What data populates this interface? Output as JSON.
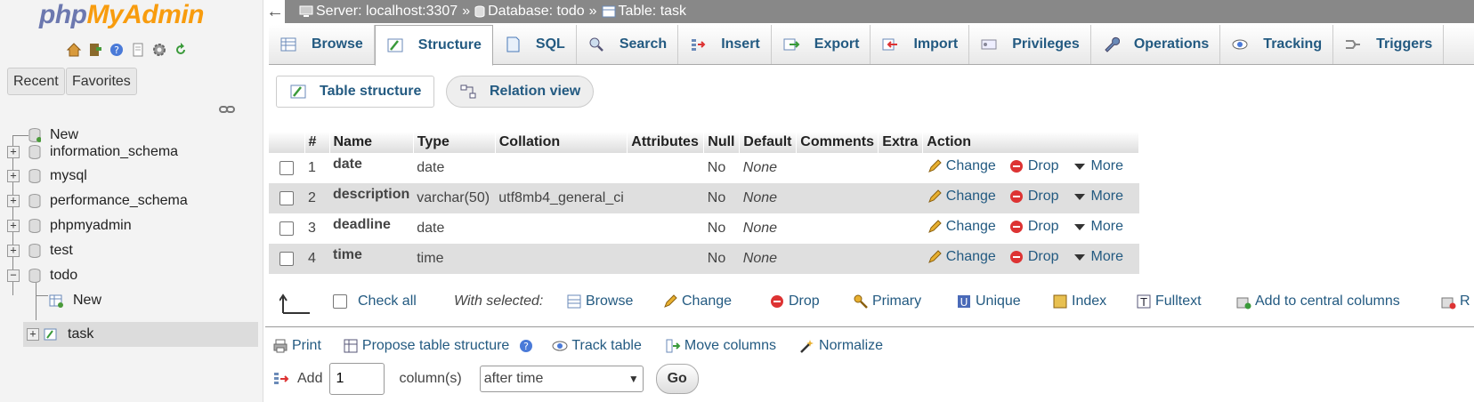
{
  "logo": {
    "part1": "php",
    "part2": "MyAdmin"
  },
  "nav": {
    "icons": [
      "home-icon",
      "exit-icon",
      "help-icon",
      "docs-icon",
      "settings-icon",
      "reload-icon"
    ],
    "recent_label": "Recent",
    "favorites_label": "Favorites",
    "tree": [
      {
        "label": "New",
        "type": "new"
      },
      {
        "label": "information_schema",
        "type": "db"
      },
      {
        "label": "mysql",
        "type": "db"
      },
      {
        "label": "performance_schema",
        "type": "db"
      },
      {
        "label": "phpmyadmin",
        "type": "db"
      },
      {
        "label": "test",
        "type": "db"
      },
      {
        "label": "todo",
        "type": "db",
        "expanded": true
      },
      {
        "label": "New",
        "type": "new-table"
      },
      {
        "label": "task",
        "type": "table",
        "selected": true
      }
    ]
  },
  "breadcrumb": {
    "server": "Server: localhost:3307",
    "database": "Database: todo",
    "table": "Table: task",
    "separator": "»"
  },
  "tabs": [
    {
      "label": "Browse",
      "icon": "browse-icon"
    },
    {
      "label": "Structure",
      "icon": "structure-icon",
      "active": true
    },
    {
      "label": "SQL",
      "icon": "sql-icon"
    },
    {
      "label": "Search",
      "icon": "search-icon"
    },
    {
      "label": "Insert",
      "icon": "insert-icon"
    },
    {
      "label": "Export",
      "icon": "export-icon"
    },
    {
      "label": "Import",
      "icon": "import-icon"
    },
    {
      "label": "Privileges",
      "icon": "privileges-icon"
    },
    {
      "label": "Operations",
      "icon": "operations-icon"
    },
    {
      "label": "Tracking",
      "icon": "tracking-icon"
    },
    {
      "label": "Triggers",
      "icon": "triggers-icon"
    }
  ],
  "subtabs": {
    "structure": "Table structure",
    "relation": "Relation view"
  },
  "table": {
    "headers": [
      "#",
      "Name",
      "Type",
      "Collation",
      "Attributes",
      "Null",
      "Default",
      "Comments",
      "Extra",
      "Action"
    ],
    "rows": [
      {
        "num": "1",
        "name": "date",
        "type": "date",
        "collation": "",
        "attributes": "",
        "null": "No",
        "default": "None",
        "comments": "",
        "extra": ""
      },
      {
        "num": "2",
        "name": "description",
        "type": "varchar(50)",
        "collation": "utf8mb4_general_ci",
        "attributes": "",
        "null": "No",
        "default": "None",
        "comments": "",
        "extra": ""
      },
      {
        "num": "3",
        "name": "deadline",
        "type": "date",
        "collation": "",
        "attributes": "",
        "null": "No",
        "default": "None",
        "comments": "",
        "extra": ""
      },
      {
        "num": "4",
        "name": "time",
        "type": "time",
        "collation": "",
        "attributes": "",
        "null": "No",
        "default": "None",
        "comments": "",
        "extra": ""
      }
    ],
    "actions": {
      "change": "Change",
      "drop": "Drop",
      "more": "More"
    }
  },
  "bulk": {
    "check_all": "Check all",
    "with_selected": "With selected:",
    "browse": "Browse",
    "change": "Change",
    "drop": "Drop",
    "primary": "Primary",
    "unique": "Unique",
    "index": "Index",
    "fulltext": "Fulltext",
    "central": "Add to central columns",
    "cut_off": "R"
  },
  "bottom": {
    "print": "Print",
    "propose": "Propose table structure",
    "track": "Track table",
    "move": "Move columns",
    "normalize": "Normalize"
  },
  "add_columns": {
    "add_label": "Add",
    "count": "1",
    "columns_label": "column(s)",
    "position": "after time",
    "go": "Go"
  },
  "colors": {
    "link": "#235a81",
    "logo_php": "#6c78af",
    "logo_myadmin": "#f89c0e",
    "topbar": "#888888"
  }
}
